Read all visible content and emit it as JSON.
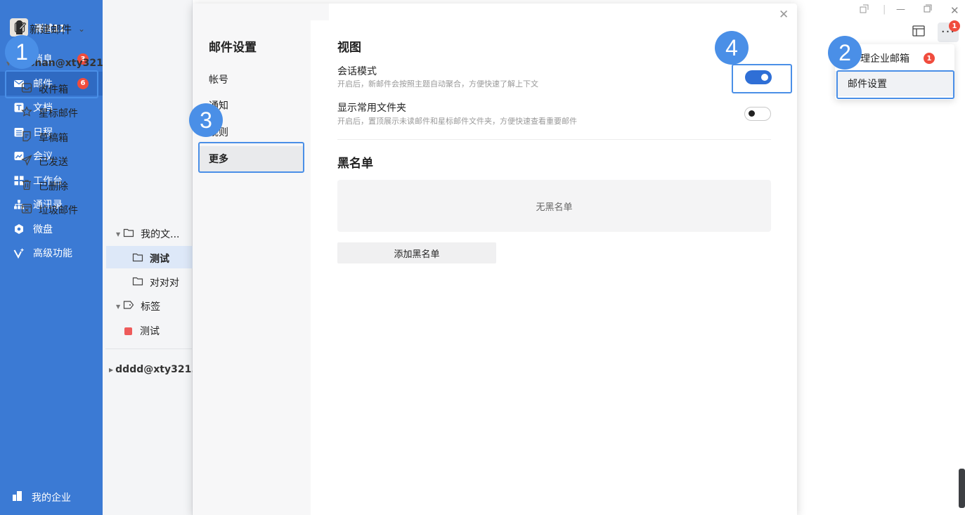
{
  "user": {
    "name": "测试11"
  },
  "sidebar": {
    "items": [
      {
        "label": "消息",
        "icon": "chat-icon",
        "badge": "3"
      },
      {
        "label": "邮件",
        "icon": "mail-icon",
        "badge": "6",
        "active": true
      },
      {
        "label": "文档",
        "icon": "document-icon"
      },
      {
        "label": "日程",
        "icon": "calendar-icon"
      },
      {
        "label": "会议",
        "icon": "meeting-icon"
      },
      {
        "label": "工作台",
        "icon": "workbench-icon"
      },
      {
        "label": "通讯录",
        "icon": "contacts-icon"
      },
      {
        "label": "微盘",
        "icon": "drive-icon"
      },
      {
        "label": "高级功能",
        "icon": "advanced-icon"
      }
    ],
    "bottom_label": "我的企业"
  },
  "folders": {
    "compose_label": "新建邮件",
    "account1": "wushan@xty321",
    "items": {
      "inbox": "收件箱",
      "starred": "星标邮件",
      "drafts": "草稿箱",
      "sent": "已发送",
      "deleted": "已删除",
      "junk": "垃圾邮件",
      "my_folders": "我的文...",
      "test_folder": "测试",
      "duiduidui": "对对对",
      "tags": "标签",
      "tag_test": "测试"
    },
    "account2": "dddd@xty321..."
  },
  "toolbar": {
    "more_badge": "1"
  },
  "dropdown": {
    "item1_label": "理企业邮箱",
    "item1_badge": "1",
    "item2_label": "邮件设置"
  },
  "settings": {
    "title": "邮件设置",
    "tabs": {
      "account": "帐号",
      "notify": "通知",
      "rules": "规则",
      "more": "更多"
    },
    "view_title": "视图",
    "conversation": {
      "name": "会话模式",
      "desc": "开启后，新邮件会按照主题自动聚合，方便快速了解上下文",
      "on": true
    },
    "common_folders": {
      "name": "显示常用文件夹",
      "desc": "开启后，置顶展示未读邮件和星标邮件文件夹，方便快速查看重要邮件",
      "on": false
    },
    "blacklist_title": "黑名单",
    "blacklist_empty": "无黑名单",
    "add_blacklist": "添加黑名单"
  },
  "callouts": {
    "c1": "1",
    "c2": "2",
    "c3": "3",
    "c4": "4"
  },
  "colors": {
    "sidebar": "#3b7ad4",
    "accent": "#2f6fd6",
    "badge": "#f04c3d",
    "callout": "#4a8fe7"
  }
}
